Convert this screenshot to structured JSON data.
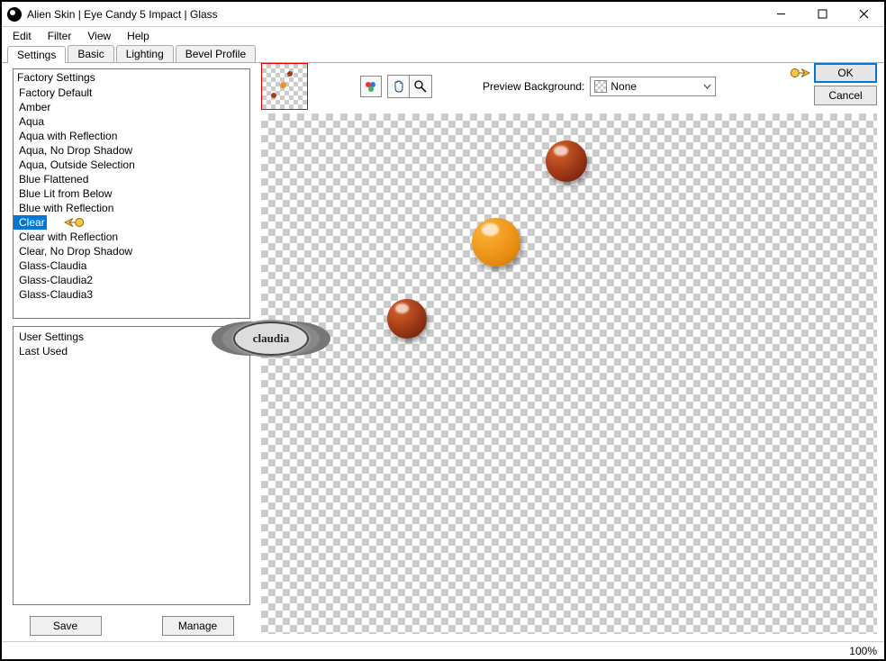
{
  "window": {
    "title": "Alien Skin | Eye Candy 5 Impact | Glass"
  },
  "menu": {
    "items": [
      "Edit",
      "Filter",
      "View",
      "Help"
    ]
  },
  "tabs": {
    "items": [
      "Settings",
      "Basic",
      "Lighting",
      "Bevel Profile"
    ],
    "active_index": 0
  },
  "factory_list": {
    "header": "Factory Settings",
    "items": [
      "Factory Default",
      "Amber",
      "Aqua",
      "Aqua with Reflection",
      "Aqua, No Drop Shadow",
      "Aqua, Outside Selection",
      "Blue Flattened",
      "Blue Lit from Below",
      "Blue with Reflection",
      "Clear",
      "Clear with Reflection",
      "Clear, No Drop Shadow",
      "Glass-Claudia",
      "Glass-Claudia2",
      "Glass-Claudia3"
    ],
    "selected_index": 9
  },
  "user_list": {
    "header": "User Settings",
    "items": [
      "Last Used"
    ]
  },
  "panel_buttons": {
    "save": "Save",
    "manage": "Manage"
  },
  "preview": {
    "bg_label": "Preview Background:",
    "bg_selected": "None"
  },
  "dialog_buttons": {
    "ok": "OK",
    "cancel": "Cancel"
  },
  "watermark": "claudia",
  "status": {
    "zoom": "100%"
  }
}
